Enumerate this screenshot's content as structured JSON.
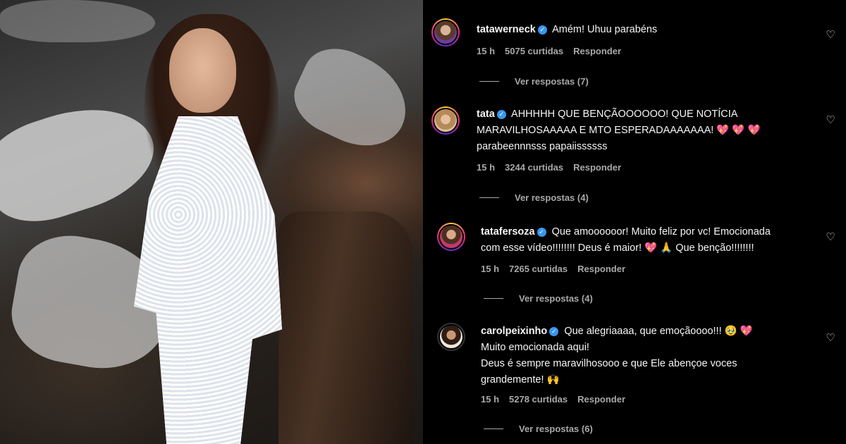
{
  "photo": {
    "description_icon": "photo-of-woman-in-white-lace-dress"
  },
  "comments": [
    {
      "username": "tatawerneck",
      "verified": true,
      "text_lines": [
        "Amém! Uhuu parabéns"
      ],
      "time": "15 h",
      "likes": "5075 curtidas",
      "reply": "Responder",
      "view_replies": "Ver respostas (7)"
    },
    {
      "username": "tata",
      "verified": true,
      "text_lines": [
        "AHHHHH QUE BENÇÃOOOOOO! QUE NOTÍCIA",
        "MARAVILHOSAAAAA E MTO ESPERADAAAAAAA!",
        "parabeennnsss papaiissssss"
      ],
      "emoji_line1": "",
      "emoji_line2": "💖 💖 💖",
      "time": "15 h",
      "likes": "3244 curtidas",
      "reply": "Responder",
      "view_replies": "Ver respostas (4)"
    },
    {
      "username": "tatafersoza",
      "verified": true,
      "text_lines": [
        "Que amoooooor! Muito feliz por vc! Emocionada",
        "com esse vídeo!!!!!!!! Deus é maior!",
        "Que benção!!!!!!!!"
      ],
      "emoji_line2": "💖 🙏",
      "time": "15 h",
      "likes": "7265 curtidas",
      "reply": "Responder",
      "view_replies": "Ver respostas (4)"
    },
    {
      "username": "carolpeixinho",
      "verified": true,
      "text_lines": [
        "Que alegriaaaa, que emoçãoooo!!!",
        "Muito emocionada aqui!",
        "Deus é sempre maravilhosooo e que Ele abençoe voces",
        "grandemente!"
      ],
      "emoji_line1": "🥹 💖",
      "emoji_line4": "🙌",
      "time": "15 h",
      "likes": "5278 curtidas",
      "reply": "Responder",
      "view_replies": "Ver respostas (6)"
    }
  ],
  "colors": {
    "background": "#000000",
    "text": "#f5f5f5",
    "meta": "#a8a8a8",
    "verified": "#3897f0"
  },
  "icons": {
    "like": "heart-outline-icon",
    "verified": "verified-badge-icon"
  }
}
